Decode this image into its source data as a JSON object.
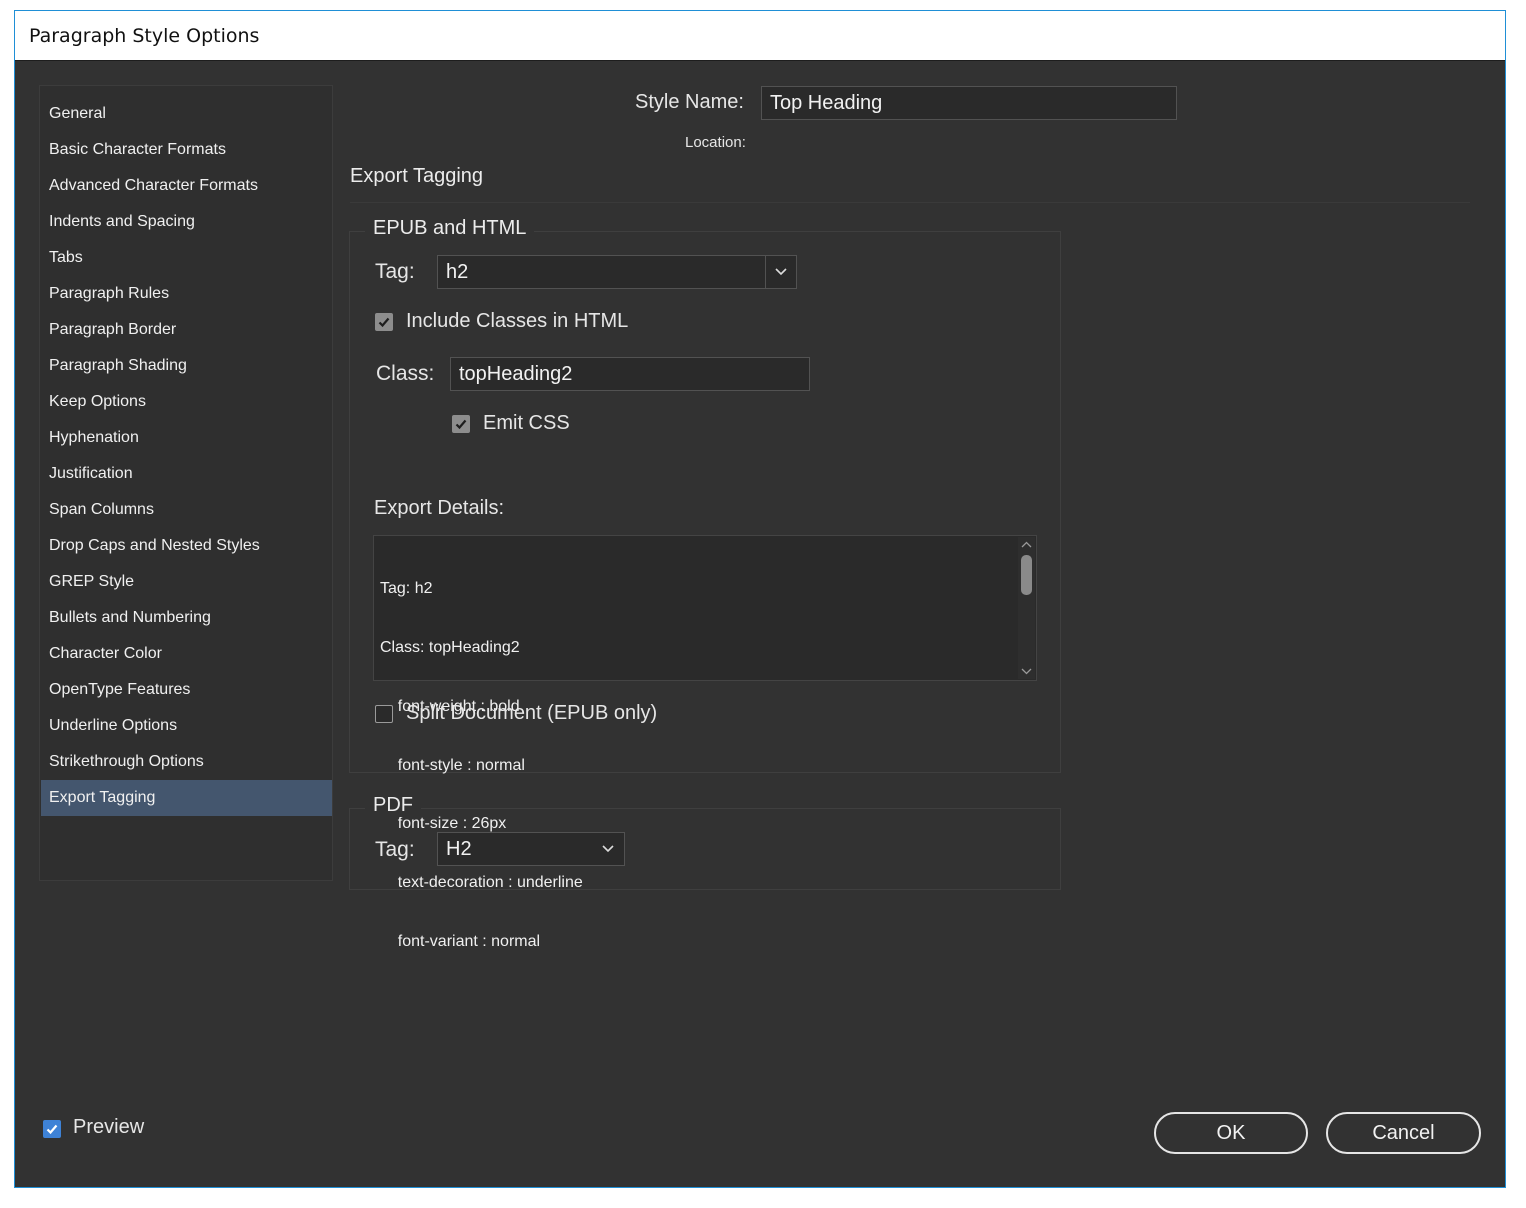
{
  "window": {
    "title": "Paragraph Style Options"
  },
  "sidebar": {
    "items": [
      "General",
      "Basic Character Formats",
      "Advanced Character Formats",
      "Indents and Spacing",
      "Tabs",
      "Paragraph Rules",
      "Paragraph Border",
      "Paragraph Shading",
      "Keep Options",
      "Hyphenation",
      "Justification",
      "Span Columns",
      "Drop Caps and Nested Styles",
      "GREP Style",
      "Bullets and Numbering",
      "Character Color",
      "OpenType Features",
      "Underline Options",
      "Strikethrough Options",
      "Export Tagging"
    ],
    "selected": "Export Tagging"
  },
  "header": {
    "style_name_label": "Style Name:",
    "style_name_value": "Top Heading",
    "location_label": "Location:",
    "section_title": "Export Tagging"
  },
  "epub": {
    "legend": "EPUB and HTML",
    "tag_label": "Tag:",
    "tag_value": "h2",
    "include_classes_label": "Include Classes in HTML",
    "include_classes_checked": true,
    "class_label": "Class:",
    "class_value": "topHeading2",
    "emit_css_label": "Emit CSS",
    "emit_css_checked": true,
    "export_details_label": "Export Details:",
    "export_details_lines": [
      "Tag: h2",
      "Class: topHeading2",
      "    font-weight : bold",
      "    font-style : normal",
      "    font-size : 26px",
      "    text-decoration : underline",
      "    font-variant : normal"
    ],
    "split_document_label": "Split Document (EPUB only)",
    "split_document_checked": false
  },
  "pdf": {
    "legend": "PDF",
    "tag_label": "Tag:",
    "tag_value": "H2"
  },
  "footer": {
    "preview_label": "Preview",
    "preview_checked": true,
    "ok_label": "OK",
    "cancel_label": "Cancel"
  },
  "colors": {
    "background": "#323232",
    "selected_item": "#44566e",
    "checkbox_accent": "#3e82d6",
    "window_border": "#1f8fd6"
  }
}
